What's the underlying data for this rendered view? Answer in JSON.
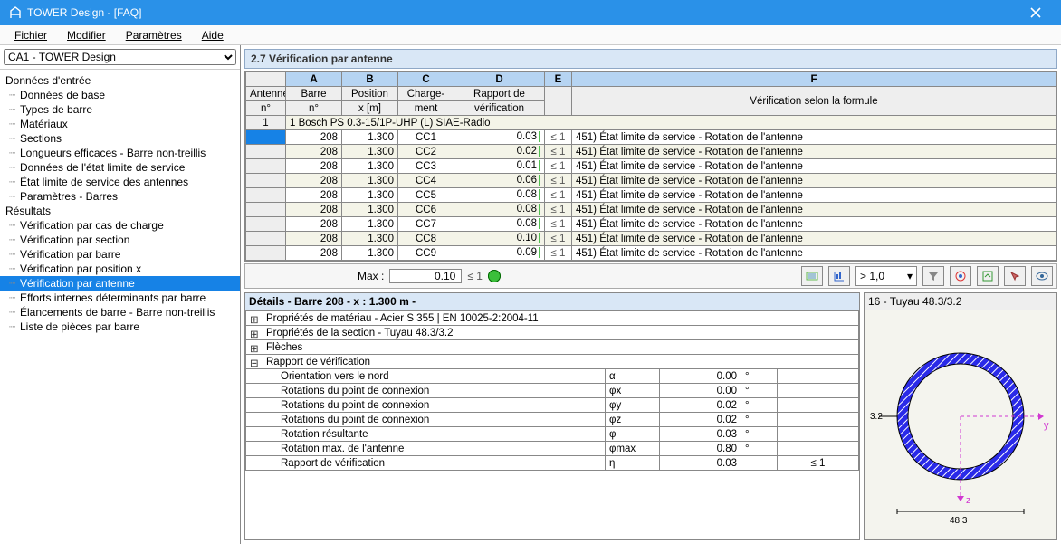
{
  "window": {
    "title": "TOWER Design - [FAQ]"
  },
  "menu": [
    "Fichier",
    "Modifier",
    "Paramètres",
    "Aide"
  ],
  "project_selector": "CA1 - TOWER Design",
  "tree": {
    "g1": "Données d'entrée",
    "g1_items": [
      "Données de base",
      "Types de barre",
      "Matériaux",
      "Sections",
      "Longueurs efficaces - Barre non-treillis",
      "Données de l'état limite de service",
      "État limite de service des antennes",
      "Paramètres - Barres"
    ],
    "g2": "Résultats",
    "g2_items": [
      "Vérification par cas de charge",
      "Vérification par section",
      "Vérification par barre",
      "Vérification par position x",
      "Vérification par antenne",
      "Efforts internes déterminants par barre",
      "Élancements de barre - Barre non-treillis",
      "Liste de pièces par barre"
    ]
  },
  "selected_tree_index": 4,
  "panel_title": "2.7 Vérification par antenne",
  "cols": {
    "row0": [
      "A",
      "B",
      "C",
      "D",
      "E",
      "F"
    ],
    "row1": [
      "Antenne",
      "Barre",
      "Position",
      "Charge-",
      "Rapport de",
      ""
    ],
    "row2": [
      "n°",
      "n°",
      "x [m]",
      "ment",
      "vérification",
      "Vérification selon la formule"
    ]
  },
  "section_label": "1 Bosch PS 0.3-15/1P-UHP (L) SIAE-Radio",
  "rows": [
    {
      "barre": "208",
      "x": "1.300",
      "cc": "CC1",
      "ratio": "0.03",
      "le": "≤ 1",
      "formula": "451) État limite de service - Rotation de l'antenne"
    },
    {
      "barre": "208",
      "x": "1.300",
      "cc": "CC2",
      "ratio": "0.02",
      "le": "≤ 1",
      "formula": "451) État limite de service - Rotation de l'antenne"
    },
    {
      "barre": "208",
      "x": "1.300",
      "cc": "CC3",
      "ratio": "0.01",
      "le": "≤ 1",
      "formula": "451) État limite de service - Rotation de l'antenne"
    },
    {
      "barre": "208",
      "x": "1.300",
      "cc": "CC4",
      "ratio": "0.06",
      "le": "≤ 1",
      "formula": "451) État limite de service - Rotation de l'antenne"
    },
    {
      "barre": "208",
      "x": "1.300",
      "cc": "CC5",
      "ratio": "0.08",
      "le": "≤ 1",
      "formula": "451) État limite de service - Rotation de l'antenne"
    },
    {
      "barre": "208",
      "x": "1.300",
      "cc": "CC6",
      "ratio": "0.08",
      "le": "≤ 1",
      "formula": "451) État limite de service - Rotation de l'antenne"
    },
    {
      "barre": "208",
      "x": "1.300",
      "cc": "CC7",
      "ratio": "0.08",
      "le": "≤ 1",
      "formula": "451) État limite de service - Rotation de l'antenne"
    },
    {
      "barre": "208",
      "x": "1.300",
      "cc": "CC8",
      "ratio": "0.10",
      "le": "≤ 1",
      "formula": "451) État limite de service - Rotation de l'antenne"
    },
    {
      "barre": "208",
      "x": "1.300",
      "cc": "CC9",
      "ratio": "0.09",
      "le": "≤ 1",
      "formula": "451) État limite de service - Rotation de l'antenne"
    }
  ],
  "summary": {
    "label": "Max :",
    "value": "0.10",
    "le": "≤ 1",
    "dropdown": "> 1,0"
  },
  "details_title": "Détails - Barre 208 - x : 1.300 m -",
  "detail_groups": [
    {
      "label": "Propriétés de matériau - Acier S 355 | EN 10025-2:2004-11",
      "type": "plus"
    },
    {
      "label": "Propriétés de la section  -  Tuyau 48.3/3.2",
      "type": "plus"
    },
    {
      "label": "Flèches",
      "type": "plus"
    },
    {
      "label": "Rapport de vérification",
      "type": "minus"
    }
  ],
  "detail_rows": [
    {
      "name": "Orientation vers le nord",
      "sym": "α",
      "val": "0.00",
      "unit": "°",
      "ok": ""
    },
    {
      "name": "Rotations du point de connexion",
      "sym": "φx",
      "val": "0.00",
      "unit": "°",
      "ok": ""
    },
    {
      "name": "Rotations du point de connexion",
      "sym": "φy",
      "val": "0.02",
      "unit": "°",
      "ok": ""
    },
    {
      "name": "Rotations du point de connexion",
      "sym": "φz",
      "val": "0.02",
      "unit": "°",
      "ok": ""
    },
    {
      "name": "Rotation résultante",
      "sym": "φ",
      "val": "0.03",
      "unit": "°",
      "ok": ""
    },
    {
      "name": "Rotation max. de l'antenne",
      "sym": "φmax",
      "val": "0.80",
      "unit": "°",
      "ok": ""
    },
    {
      "name": "Rapport de vérification",
      "sym": "η",
      "val": "0.03",
      "unit": "",
      "ok": "≤ 1"
    }
  ],
  "figure": {
    "title": "16 - Tuyau 48.3/3.2",
    "dim1": "3.2",
    "dim2": "48.3",
    "y": "y",
    "z": "z"
  }
}
